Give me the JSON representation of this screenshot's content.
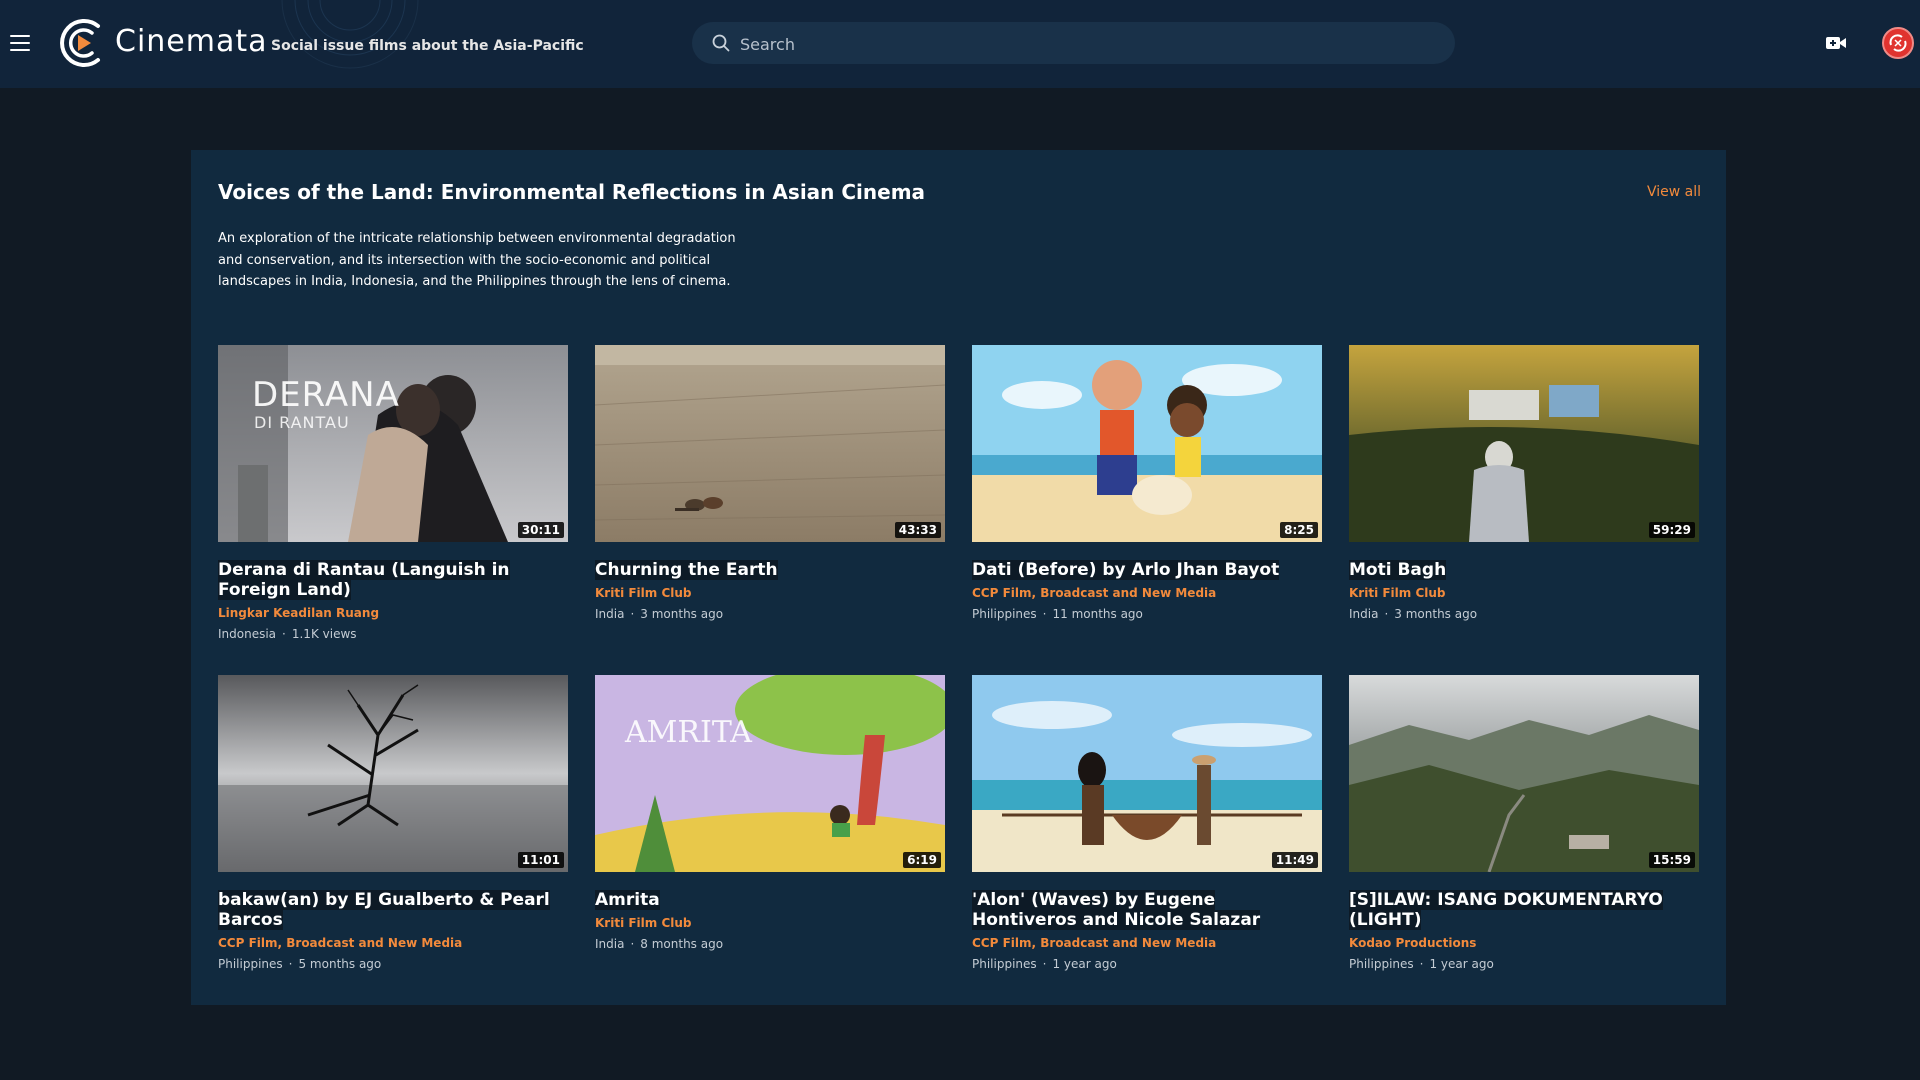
{
  "header": {
    "brand": "Cinemata",
    "tagline": "Social issue films about the Asia-Pacific",
    "search_placeholder": "Search"
  },
  "section": {
    "title": "Voices of the Land: Environmental Reflections in Asian Cinema",
    "view_all": "View all",
    "description": "An exploration of the intricate relationship between environmental degradation and conservation, and its intersection with the socio-economic and political landscapes in India, Indonesia, and the Philippines through the lens of cinema."
  },
  "videos": [
    {
      "title": "Derana di Rantau (Languish in Foreign Land)",
      "org": "Lingkar Keadilan Ruang",
      "country": "Indonesia",
      "info": "1.1K views",
      "duration": "30:11",
      "thumb_text": "DERANA",
      "thumb_subtext": "DI RANTAU"
    },
    {
      "title": "Churning the Earth",
      "org": "Kriti Film Club",
      "country": "India",
      "info": "3 months ago",
      "duration": "43:33"
    },
    {
      "title": "Dati (Before) by Arlo Jhan Bayot",
      "org": "CCP Film, Broadcast and New Media",
      "country": "Philippines",
      "info": "11 months ago",
      "duration": "8:25"
    },
    {
      "title": "Moti Bagh",
      "org": "Kriti Film Club",
      "country": "India",
      "info": "3 months ago",
      "duration": "59:29"
    },
    {
      "title": "bakaw(an) by EJ Gualberto & Pearl Barcos",
      "org": "CCP Film, Broadcast and New Media",
      "country": "Philippines",
      "info": "5 months ago",
      "duration": "11:01"
    },
    {
      "title": "Amrita",
      "org": "Kriti Film Club",
      "country": "India",
      "info": "8 months ago",
      "duration": "6:19",
      "thumb_text": "AMRITA"
    },
    {
      "title": "'Alon' (Waves) by Eugene Hontiveros and Nicole Salazar",
      "org": "CCP Film, Broadcast and New Media",
      "country": "Philippines",
      "info": "1 year ago",
      "duration": "11:49"
    },
    {
      "title": "[S]ILAW: ISANG DOKUMENTARYO (LIGHT)",
      "org": "Kodao Productions",
      "country": "Philippines",
      "info": "1 year ago",
      "duration": "15:59"
    }
  ],
  "colors": {
    "accent": "#f28a3c",
    "header_bg": "#11243a",
    "page_bg": "#111a24",
    "section_bg": "#112a3f"
  }
}
